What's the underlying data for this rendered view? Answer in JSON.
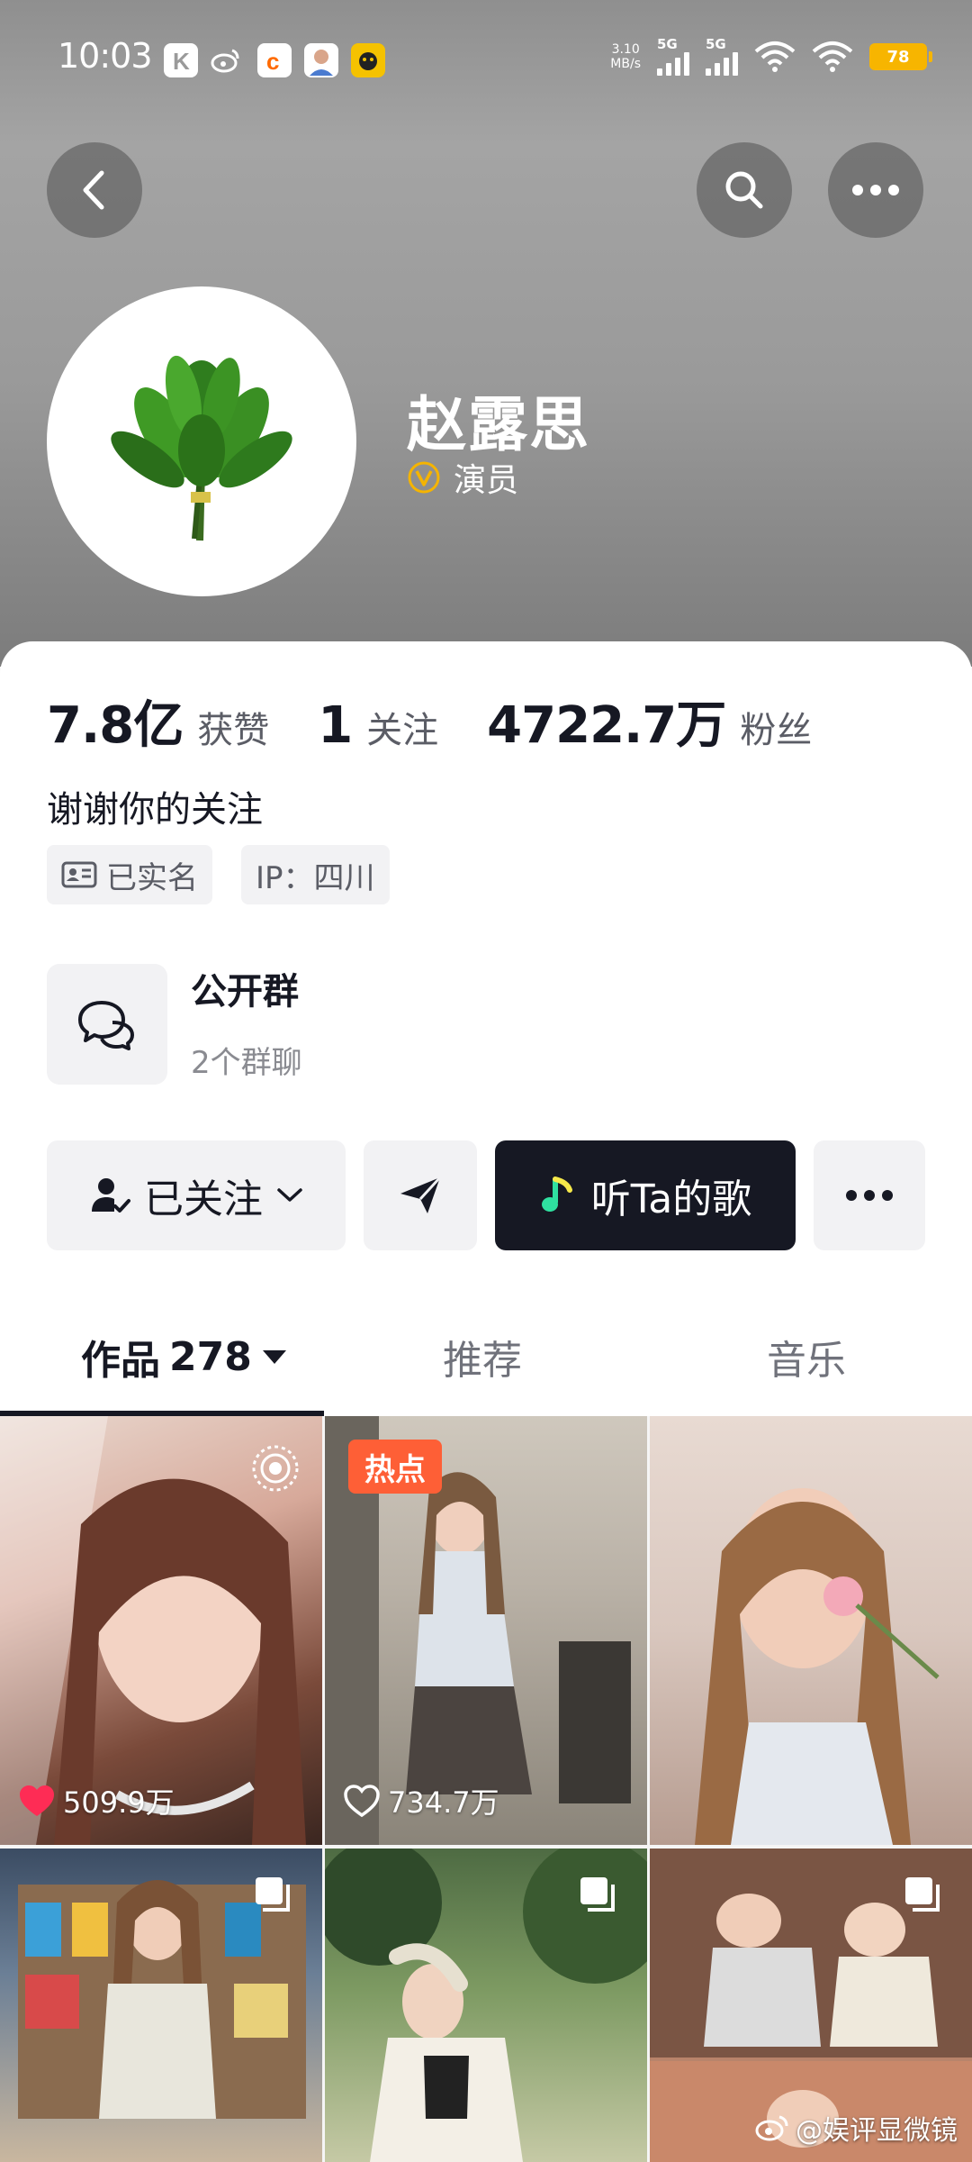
{
  "status_bar": {
    "time": "10:03",
    "net_speed_value": "3.10",
    "net_speed_unit": "MB/s",
    "signal1_label": "5G",
    "signal2_label": "5G",
    "battery": "78"
  },
  "profile": {
    "name": "赵露思",
    "verified_label": "演员",
    "stats": [
      {
        "value": "7.8亿",
        "label": "获赞"
      },
      {
        "value": "1",
        "label": "关注"
      },
      {
        "value": "4722.7万",
        "label": "粉丝"
      }
    ],
    "bio": "谢谢你的关注",
    "tags": {
      "realname": "已实名",
      "ip": "IP：四川"
    },
    "group": {
      "title": "公开群",
      "subtitle": "2个群聊"
    }
  },
  "actions": {
    "follow_label": "已关注",
    "music_label": "听Ta的歌"
  },
  "tabs": {
    "works_label": "作品",
    "works_count": "278",
    "recommend_label": "推荐",
    "music_label": "音乐"
  },
  "grid": {
    "items": [
      {
        "likes": "509.9万",
        "liked": true,
        "badge": ""
      },
      {
        "likes": "734.7万",
        "liked": false,
        "badge": "热点"
      },
      {
        "likes": "",
        "liked": false,
        "badge": ""
      },
      {
        "likes": "",
        "liked": false,
        "badge": ""
      },
      {
        "likes": "",
        "liked": false,
        "badge": ""
      },
      {
        "likes": "",
        "liked": false,
        "badge": ""
      }
    ]
  },
  "watermark": "@娱评显微镜",
  "colors": {
    "accent_dark": "#161823",
    "hot_badge": "#fe5f36",
    "battery": "#f7b500",
    "verify_gold": "#f5b400",
    "like_red": "#fe2c55"
  }
}
